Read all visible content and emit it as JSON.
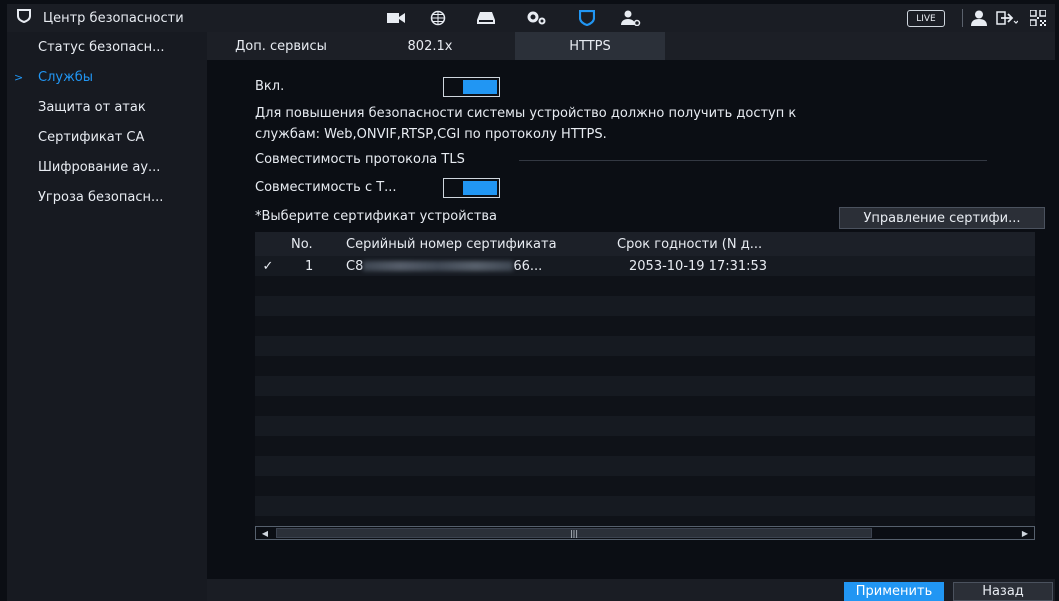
{
  "header": {
    "title": "Центр безопасности",
    "live_label": "LIVE",
    "icons": [
      "shield-icon",
      "camera-icon",
      "network-globe-icon",
      "storage-icon",
      "settings-gears-icon",
      "security-shield-icon",
      "account-settings-icon",
      "user-icon",
      "logout-icon",
      "qr-code-icon"
    ],
    "accent_color": "#2196f3"
  },
  "sidebar": {
    "items": [
      {
        "label": "Статус безопасн..."
      },
      {
        "label": "Службы"
      },
      {
        "label": "Защита от атак"
      },
      {
        "label": "Сертификат CA"
      },
      {
        "label": "Шифрование ау..."
      },
      {
        "label": "Угроза безопасн..."
      }
    ],
    "active_index": 1
  },
  "tabs": [
    {
      "label": "Доп. сервисы"
    },
    {
      "label": "802.1x"
    },
    {
      "label": "HTTPS"
    }
  ],
  "active_tab": 2,
  "https": {
    "enable_label": "Вкл.",
    "enable_on": true,
    "description_line1": "Для повышения безопасности системы устройство должно получить доступ к",
    "description_line2": "службам: Web,ONVIF,RTSP,CGI по протоколу HTTPS.",
    "tls_section": "Совместимость протокола TLS",
    "tls_compat_label": "Совместимость с Т...",
    "tls_compat_on": true,
    "select_cert_label": "*Выберите сертификат устройства",
    "manage_button": "Управление сертифи..."
  },
  "cert_table": {
    "columns": [
      "No.",
      "Серийный номер сертификата",
      "Срок годности (N д..."
    ],
    "rows": [
      {
        "checked": true,
        "check": "✓",
        "no": "1",
        "serial_prefix": "C8",
        "serial_suffix": "66...",
        "expiry": "2053-10-19 17:31:53"
      }
    ]
  },
  "footer": {
    "apply": "Применить",
    "back": "Назад"
  }
}
